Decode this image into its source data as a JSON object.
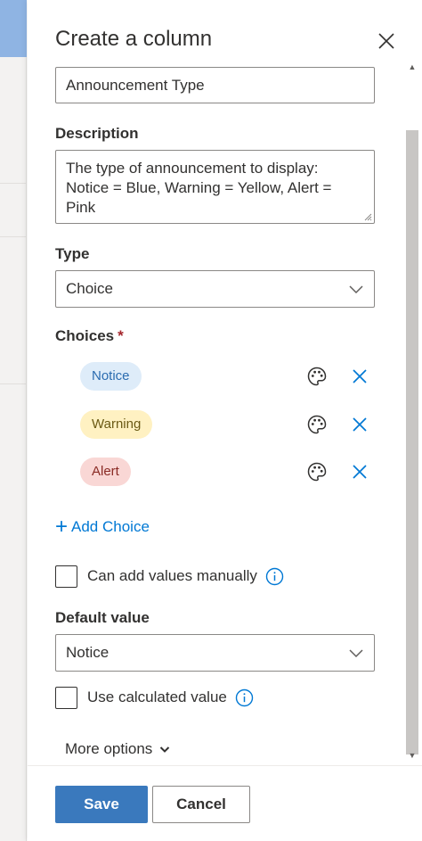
{
  "panel": {
    "title": "Create a column"
  },
  "name_field": {
    "value": "Announcement Type"
  },
  "description": {
    "label": "Description",
    "value": "The type of announcement to display: Notice = Blue, Warning = Yellow, Alert = Pink"
  },
  "type": {
    "label": "Type",
    "selected": "Choice"
  },
  "choices": {
    "label": "Choices",
    "required_mark": "*",
    "items": [
      {
        "label": "Notice",
        "bg": "#deecf9",
        "fg": "#2b6cb0"
      },
      {
        "label": "Warning",
        "bg": "#fff1c2",
        "fg": "#6b5a14"
      },
      {
        "label": "Alert",
        "bg": "#f9d7d5",
        "fg": "#8a2b25"
      }
    ],
    "add_label": "Add Choice"
  },
  "manual_values": {
    "label": "Can add values manually",
    "checked": false
  },
  "default_value": {
    "label": "Default value",
    "selected": "Notice"
  },
  "calculated": {
    "label": "Use calculated value",
    "checked": false
  },
  "more_options": {
    "label": "More options"
  },
  "footer": {
    "save_label": "Save",
    "cancel_label": "Cancel"
  },
  "colors": {
    "accent": "#0078d4",
    "primary_button": "#3a79bd"
  }
}
